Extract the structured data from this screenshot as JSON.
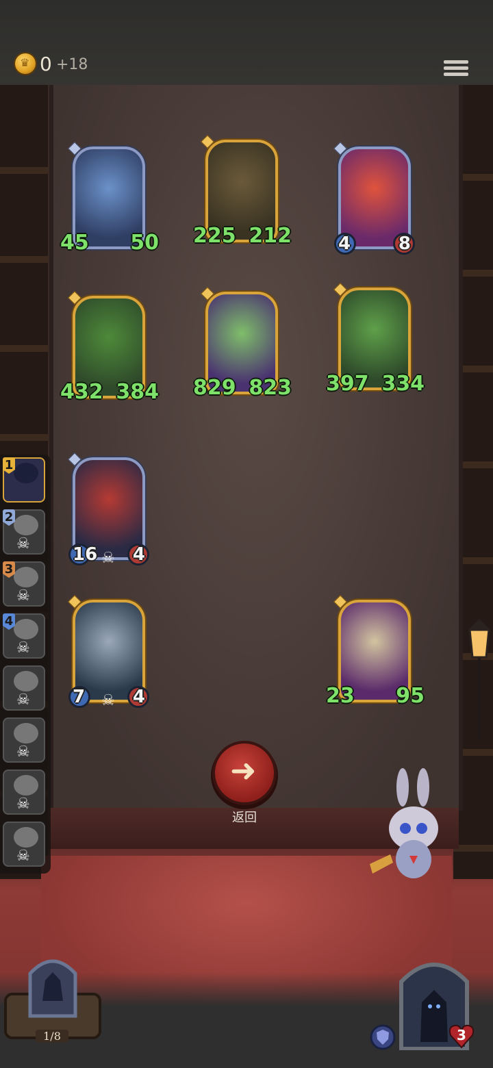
{
  "header": {
    "coins": "0",
    "coin_income": "+18",
    "menu_icon": "menu-icon"
  },
  "board": {
    "cards": [
      {
        "id": "ice-witch",
        "attack": "45",
        "health": "50",
        "frame": "silver",
        "theme": [
          "#2f3e63",
          "#6b91c9"
        ]
      },
      {
        "id": "goblin-hat",
        "attack": "225",
        "health": "212",
        "frame": "gold",
        "theme": [
          "#3a3322",
          "#6a5a3a"
        ]
      },
      {
        "id": "tomato-imp",
        "attack": "4",
        "health": "8",
        "frame": "silver",
        "theme": [
          "#6a2a6a",
          "#e0533c"
        ],
        "white_stats": true
      },
      {
        "id": "tree-spirit",
        "attack": "432",
        "health": "384",
        "frame": "gold",
        "theme": [
          "#2f4a2a",
          "#4e8a3a"
        ]
      },
      {
        "id": "forest-fairy",
        "attack": "829",
        "health": "823",
        "frame": "gold",
        "theme": [
          "#4a3270",
          "#7fbe6a"
        ]
      },
      {
        "id": "dryad",
        "attack": "397",
        "health": "334",
        "frame": "gold",
        "theme": [
          "#2e4a2a",
          "#5fa04a"
        ]
      },
      {
        "id": "crimson-dragon",
        "attack": "16",
        "health": "4",
        "frame": "silver",
        "skull": true,
        "theme": [
          "#2a2a44",
          "#b63a33"
        ],
        "white_stats": true
      },
      {
        "id": "robot",
        "attack": "7",
        "health": "4",
        "frame": "gold",
        "skull": true,
        "theme": [
          "#2a3a4a",
          "#9aa8b8"
        ],
        "white_stats": true
      },
      {
        "id": "clock-knight",
        "attack": "23",
        "health": "95",
        "frame": "gold",
        "theme": [
          "#5a2a6a",
          "#d3c4a0"
        ]
      }
    ]
  },
  "roster": [
    {
      "num": "1",
      "active": true,
      "num_color": "#e6b23a"
    },
    {
      "num": "2",
      "num_color": "#8fa8d8"
    },
    {
      "num": "3",
      "num_color": "#d88a4a"
    },
    {
      "num": "4",
      "num_color": "#5a88d8"
    },
    {
      "num": ""
    },
    {
      "num": ""
    },
    {
      "num": ""
    },
    {
      "num": ""
    }
  ],
  "back_button": {
    "label": "返回",
    "icon": "arrow-left-icon"
  },
  "deck": {
    "count": "1/8"
  },
  "hero": {
    "hp": "3"
  }
}
